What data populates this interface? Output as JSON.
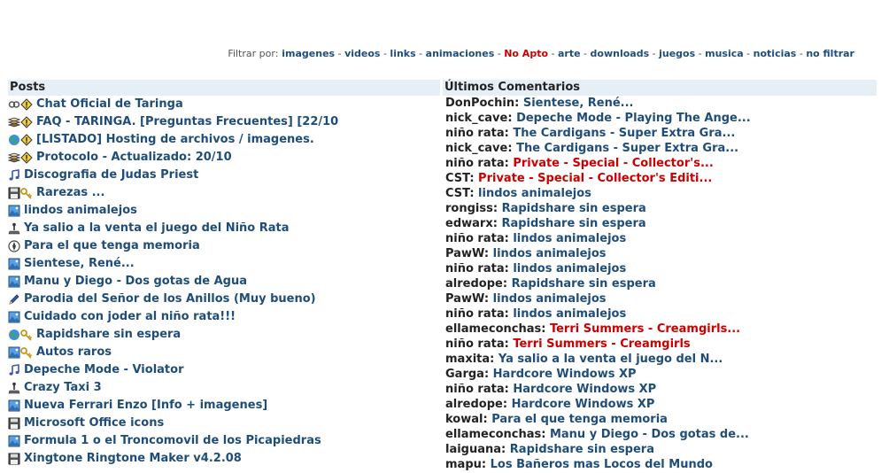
{
  "filter": {
    "label": "Filtrar por:",
    "items": [
      {
        "label": "imagenes",
        "red": false
      },
      {
        "label": "videos",
        "red": false
      },
      {
        "label": "links",
        "red": false
      },
      {
        "label": "animaciones",
        "red": false
      },
      {
        "label": "No Apto",
        "red": true
      },
      {
        "label": "arte",
        "red": false
      },
      {
        "label": "downloads",
        "red": false
      },
      {
        "label": "juegos",
        "red": false
      },
      {
        "label": "musica",
        "red": false
      },
      {
        "label": "noticias",
        "red": false
      },
      {
        "label": "no filtrar",
        "red": false
      }
    ]
  },
  "posts": {
    "title": "Posts",
    "items": [
      {
        "icons": [
          "link-icon",
          "warning-icon"
        ],
        "label": "Chat Oficial de Taringa"
      },
      {
        "icons": [
          "book-icon",
          "warning-icon"
        ],
        "label": "FAQ - TARINGA. [Preguntas Frecuentes] [22/10"
      },
      {
        "icons": [
          "globe-icon",
          "warning-icon"
        ],
        "label": "[LISTADO] Hosting de archivos / imagenes."
      },
      {
        "icons": [
          "book-icon",
          "warning-icon"
        ],
        "label": "Protocolo - Actualizado: 20/10"
      },
      {
        "icons": [
          "music-icon"
        ],
        "label": "Discografia de Judas Priest"
      },
      {
        "icons": [
          "floppy-icon",
          "key-icon"
        ],
        "label": "Rarezas ..."
      },
      {
        "icons": [
          "image-icon"
        ],
        "label": "lindos animalejos"
      },
      {
        "icons": [
          "joystick-icon"
        ],
        "label": "Ya salio a la venta el juego del Niño Rata"
      },
      {
        "icons": [
          "compass-icon"
        ],
        "label": "Para el que tenga memoria"
      },
      {
        "icons": [
          "image-icon"
        ],
        "label": "Sientese, René..."
      },
      {
        "icons": [
          "image-icon"
        ],
        "label": "Manu y Diego - Dos gotas de Agua"
      },
      {
        "icons": [
          "pencil-icon"
        ],
        "label": "Parodia del Señor de los Anillos (Muy bueno)"
      },
      {
        "icons": [
          "image-icon"
        ],
        "label": "Cuidado con joder al niño rata!!!"
      },
      {
        "icons": [
          "globe-icon",
          "key-icon"
        ],
        "label": "Rapidshare sin espera"
      },
      {
        "icons": [
          "image-icon",
          "key-icon"
        ],
        "label": "Autos raros"
      },
      {
        "icons": [
          "music-icon"
        ],
        "label": "Depeche Mode - Violator"
      },
      {
        "icons": [
          "joystick-icon"
        ],
        "label": "Crazy Taxi 3"
      },
      {
        "icons": [
          "image-icon"
        ],
        "label": "Nueva Ferrari Enzo [Info + imagenes]"
      },
      {
        "icons": [
          "floppy-icon"
        ],
        "label": "Microsoft Office icons"
      },
      {
        "icons": [
          "image-icon"
        ],
        "label": "Formula 1 o el Troncomovil de los Picapiedras"
      },
      {
        "icons": [
          "floppy-icon"
        ],
        "label": "Xingtone Ringtone Maker v4.2.08"
      }
    ]
  },
  "comments": {
    "title": "Últimos Comentarios",
    "items": [
      {
        "user": "DonPochin",
        "text": "Sientese, René...",
        "red": false
      },
      {
        "user": "nick_cave",
        "text": "Depeche Mode - Playing The Ange...",
        "red": false
      },
      {
        "user": "niño rata",
        "text": "The Cardigans - Super Extra Gra...",
        "red": false
      },
      {
        "user": "nick_cave",
        "text": "The Cardigans - Super Extra Gra...",
        "red": false
      },
      {
        "user": "niño rata",
        "text": "Private - Special - Collector's...",
        "red": true
      },
      {
        "user": "CST",
        "text": "Private - Special - Collector's Editi...",
        "red": true
      },
      {
        "user": "CST",
        "text": "lindos animalejos",
        "red": false
      },
      {
        "user": "rongiss",
        "text": "Rapidshare sin espera",
        "red": false
      },
      {
        "user": "edwarx",
        "text": "Rapidshare sin espera",
        "red": false
      },
      {
        "user": "niño rata",
        "text": "lindos animalejos",
        "red": false
      },
      {
        "user": "PawW",
        "text": "lindos animalejos",
        "red": false
      },
      {
        "user": "niño rata",
        "text": "lindos animalejos",
        "red": false
      },
      {
        "user": "alredope",
        "text": "Rapidshare sin espera",
        "red": false
      },
      {
        "user": "PawW",
        "text": "lindos animalejos",
        "red": false
      },
      {
        "user": "niño rata",
        "text": "lindos animalejos",
        "red": false
      },
      {
        "user": "ellameconchas",
        "text": "Terri Summers - Creamgirls...",
        "red": true
      },
      {
        "user": "niño rata",
        "text": "Terri Summers - Creamgirls",
        "red": true
      },
      {
        "user": "maxita",
        "text": "Ya salio a la venta el juego del N...",
        "red": false
      },
      {
        "user": "Garga",
        "text": "Hardcore Windows XP",
        "red": false
      },
      {
        "user": "niño rata",
        "text": "Hardcore Windows XP",
        "red": false
      },
      {
        "user": "alredope",
        "text": "Hardcore Windows XP",
        "red": false
      },
      {
        "user": "kowal",
        "text": "Para el que tenga memoria",
        "red": false
      },
      {
        "user": "ellameconchas",
        "text": "Manu y Diego - Dos gotas de...",
        "red": false
      },
      {
        "user": "laiguana",
        "text": "Rapidshare sin espera",
        "red": false
      },
      {
        "user": "mapu",
        "text": "Los Bañeros mas Locos del Mundo",
        "red": false
      }
    ]
  },
  "colors": {
    "link": "#1f4d7a",
    "red": "#cc0000",
    "header_bg": "#e6eef6"
  }
}
